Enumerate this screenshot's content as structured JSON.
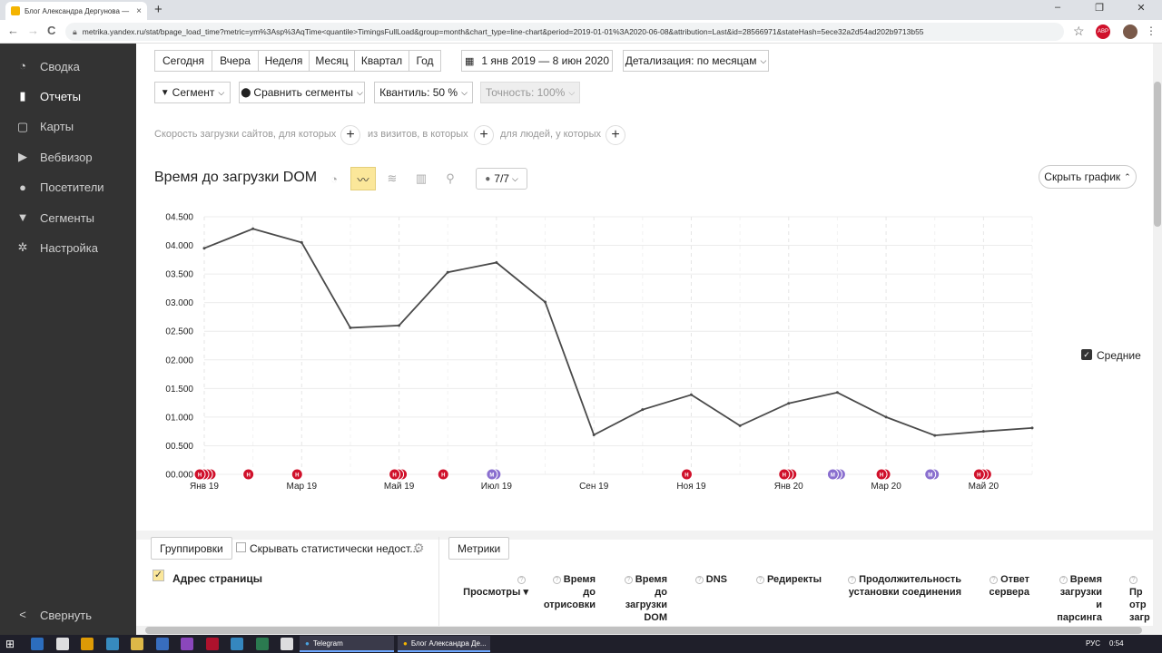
{
  "browser": {
    "tab_title": "Блог Александра Дергунова — ",
    "tab_close": "×",
    "new_tab": "+",
    "window_controls": [
      "–",
      "❐",
      "✕"
    ],
    "url": "metrika.yandex.ru/stat/bpage_load_time?metric=ym%3Asp%3AqTime<quantile>TimingsFullLoad&group=month&chart_type=line-chart&period=2019-01-01%3A2020-06-08&attribution=Last&id=28566971&stateHash=5ece32a2d54ad202b9713b55",
    "back": "←",
    "forward": "→",
    "reload": "C",
    "star": "☆",
    "abp_label": "ABP"
  },
  "sidebar": {
    "items": [
      {
        "label": "Сводка",
        "icon": "gauge-icon",
        "glyph": "◔"
      },
      {
        "label": "Отчеты",
        "icon": "bar-chart-icon",
        "glyph": "▮"
      },
      {
        "label": "Карты",
        "icon": "map-icon",
        "glyph": "▢"
      },
      {
        "label": "Вебвизор",
        "icon": "play-icon",
        "glyph": "▶"
      },
      {
        "label": "Посетители",
        "icon": "person-icon",
        "glyph": "●"
      },
      {
        "label": "Сегменты",
        "icon": "funnel-icon",
        "glyph": "▼"
      },
      {
        "label": "Настройка",
        "icon": "gear-icon",
        "glyph": "✲"
      }
    ],
    "collapse_label": "Свернуть",
    "collapse_glyph": "<"
  },
  "toolbar": {
    "periods": [
      "Сегодня",
      "Вчера",
      "Неделя",
      "Месяц",
      "Квартал",
      "Год"
    ],
    "date_range": "1 янв 2019 — 8 июн 2020",
    "detail": "Детализация: по месяцам",
    "segment": "Сегмент",
    "compare": "Сравнить сегменты",
    "quantile": "Квантиль: 50 %",
    "accuracy": "Точность: 100%"
  },
  "conditions": {
    "c1": "Скорость загрузки сайтов, для которых",
    "c2": "из визитов, в которых",
    "c3": "для людей, у которых",
    "plus": "+"
  },
  "chart_header": {
    "title": "Время до загрузки DOM",
    "annotations_count": "7/7",
    "hide_chart": "Скрыть график"
  },
  "legend": {
    "label": "Средние",
    "checked": true
  },
  "chart_data": {
    "type": "line",
    "x": [
      "Янв 19",
      "Фев 19",
      "Мар 19",
      "Апр 19",
      "Май 19",
      "Июн 19",
      "Июл 19",
      "Авг 19",
      "Сен 19",
      "Окт 19",
      "Ноя 19",
      "Дек 19",
      "Янв 20",
      "Фев 20",
      "Мар 20",
      "Апр 20",
      "Май 20",
      "Июн 20"
    ],
    "x_tick_labels": [
      "Янв 19",
      "Мар 19",
      "Май 19",
      "Июл 19",
      "Сен 19",
      "Ноя 19",
      "Янв 20",
      "Мар 20",
      "Май 20"
    ],
    "y_tick_labels": [
      "00.000",
      "00.500",
      "01.000",
      "01.500",
      "02.000",
      "02.500",
      "03.000",
      "03.500",
      "04.000",
      "04.500"
    ],
    "series": [
      {
        "name": "Средние",
        "color": "#4a4a4a",
        "values": [
          3.95,
          4.29,
          4.05,
          2.56,
          2.6,
          3.53,
          3.7,
          3.01,
          0.69,
          1.13,
          1.39,
          0.85,
          1.24,
          1.43,
          1.0,
          0.68,
          0.75,
          0.81
        ]
      }
    ],
    "ylim": [
      0,
      4.5
    ],
    "xlabel": "",
    "ylabel": "",
    "grid": true,
    "legend_position": "right"
  },
  "markers": [
    {
      "month_index": 0,
      "count": 4,
      "letter": "Н",
      "color": "#d0112b"
    },
    {
      "month_index": 1,
      "count": 1,
      "letter": "Н",
      "color": "#d0112b"
    },
    {
      "month_index": 2,
      "count": 1,
      "letter": "Н",
      "color": "#d0112b"
    },
    {
      "month_index": 4,
      "count": 3,
      "letter": "Н",
      "color": "#d0112b"
    },
    {
      "month_index": 5,
      "count": 1,
      "letter": "Н",
      "color": "#d0112b"
    },
    {
      "month_index": 6,
      "count": 2,
      "letter": "М",
      "color": "#8a6fcf"
    },
    {
      "month_index": 10,
      "count": 1,
      "letter": "Н",
      "color": "#d0112b"
    },
    {
      "month_index": 12,
      "count": 3,
      "letter": "Н",
      "color": "#d0112b"
    },
    {
      "month_index": 13,
      "count": 3,
      "letter": "М",
      "color": "#8a6fcf"
    },
    {
      "month_index": 14,
      "count": 2,
      "letter": "Н",
      "color": "#d0112b"
    },
    {
      "month_index": 15,
      "count": 2,
      "letter": "М",
      "color": "#8a6fcf"
    },
    {
      "month_index": 16,
      "count": 3,
      "letter": "Н",
      "color": "#d0112b"
    }
  ],
  "table": {
    "groupings": "Группировки",
    "hide_insufficient": "Скрывать статистически недост...",
    "metrics": "Метрики",
    "row_dimension": "Адрес страницы",
    "columns": [
      {
        "lines": [
          "Просмотры ▾"
        ]
      },
      {
        "lines": [
          "Время",
          "до",
          "отрисовки"
        ]
      },
      {
        "lines": [
          "Время",
          "до",
          "загрузки",
          "DOM"
        ]
      },
      {
        "lines": [
          "DNS"
        ]
      },
      {
        "lines": [
          "Редиректы"
        ]
      },
      {
        "lines": [
          "Продолжительность",
          "установки соединения"
        ]
      },
      {
        "lines": [
          "Ответ",
          "сервера"
        ]
      },
      {
        "lines": [
          "Время",
          "загрузки",
          "и",
          "парсинга"
        ]
      },
      {
        "lines": [
          "Пр",
          "отр",
          "",
          "загр"
        ]
      }
    ]
  },
  "taskbar": {
    "telegram": "Telegram",
    "browser": "Блог Александра Де...",
    "lang": "РУС",
    "time": "0:54"
  }
}
